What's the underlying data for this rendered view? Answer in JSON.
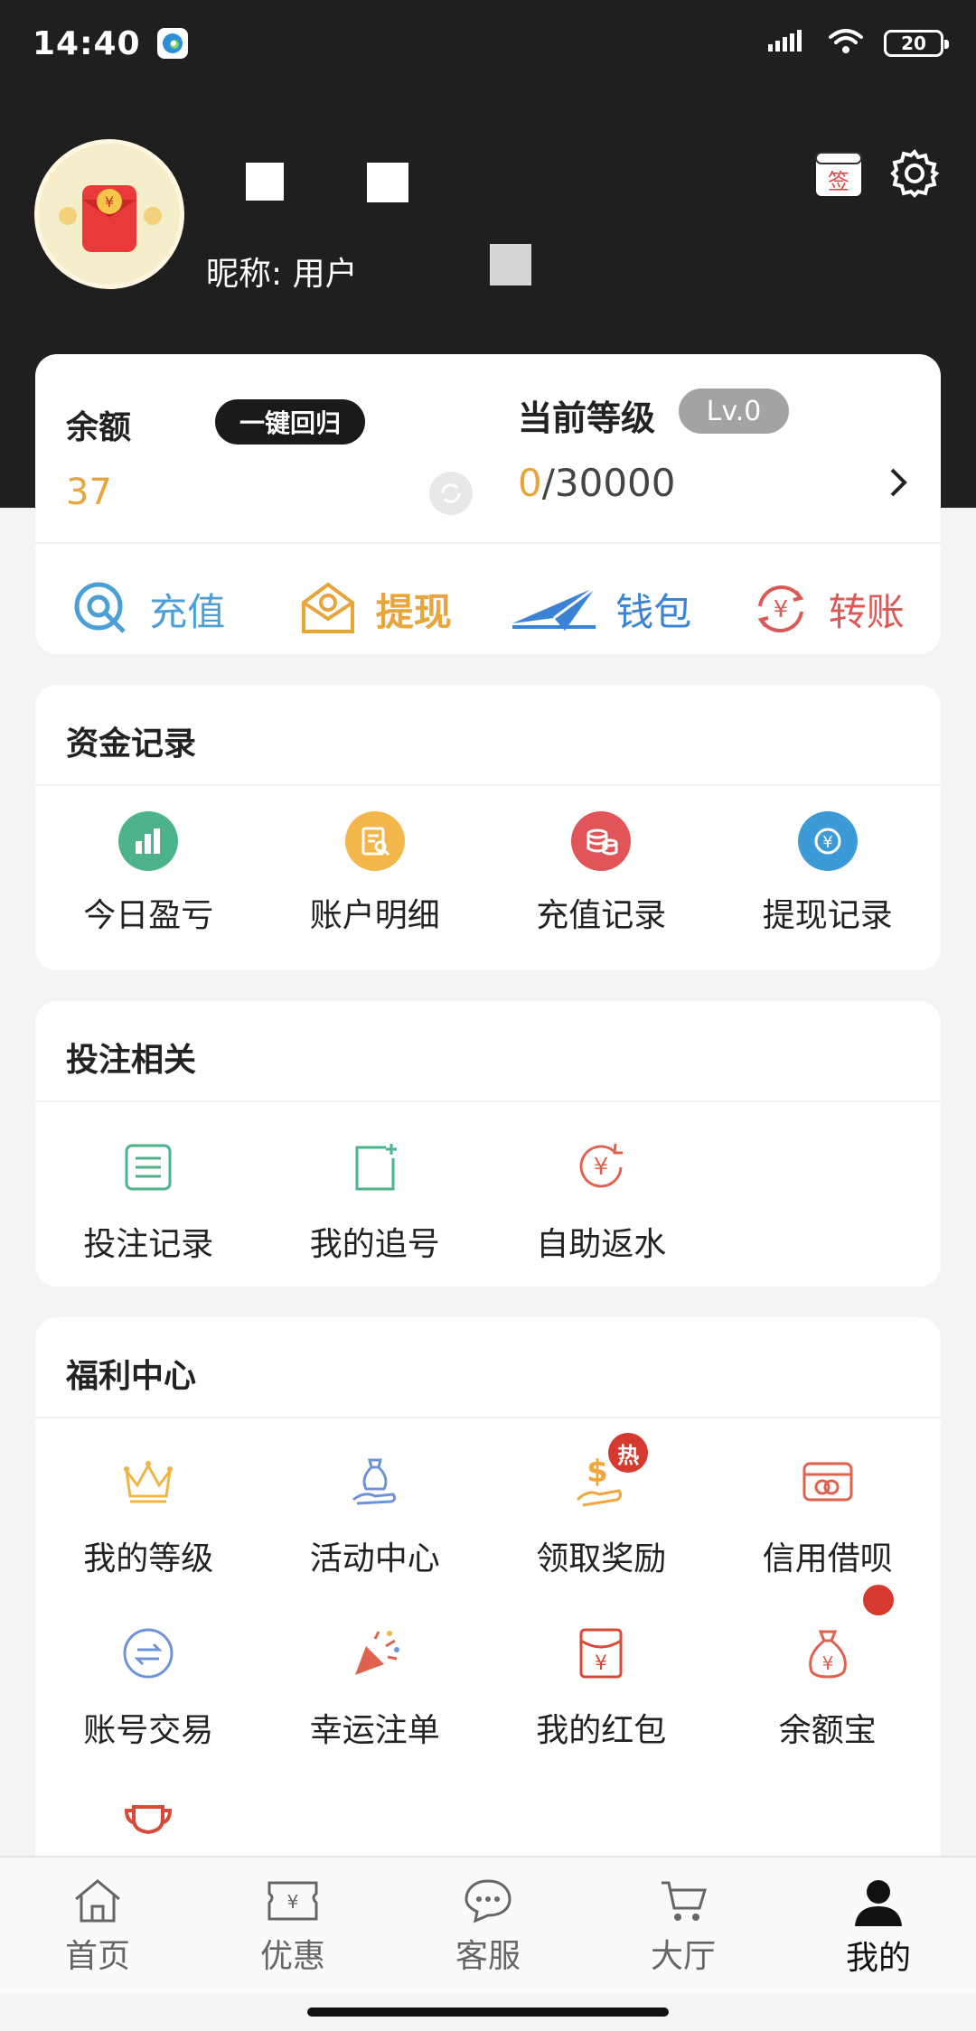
{
  "status_bar": {
    "time": "14:40",
    "battery": "20"
  },
  "profile": {
    "nickname": "昵称: 用户"
  },
  "balance": {
    "label": "余额",
    "value": "37",
    "oneclick_label": "一键回归"
  },
  "level": {
    "label": "当前等级",
    "badge": "Lv.0",
    "current": "0",
    "target": "/30000"
  },
  "quick_actions": [
    {
      "label": "充值",
      "color": "#4b9fd5",
      "icon": "recharge-icon"
    },
    {
      "label": "提现",
      "color": "#e7a53b",
      "icon": "withdraw-icon"
    },
    {
      "label": "钱包",
      "color": "#3a82d4",
      "icon": "wallet-icon"
    },
    {
      "label": "转账",
      "color": "#dc5a55",
      "icon": "transfer-icon"
    }
  ],
  "funds": {
    "title": "资金记录",
    "items": [
      {
        "label": "今日盈亏",
        "icon": "chart-icon",
        "color": "#4db38a"
      },
      {
        "label": "账户明细",
        "icon": "document-icon",
        "color": "#f3b64b"
      },
      {
        "label": "充值记录",
        "icon": "coins-icon",
        "color": "#e15558"
      },
      {
        "label": "提现记录",
        "icon": "withdraw-record-icon",
        "color": "#3c9bd6"
      }
    ]
  },
  "betting": {
    "title": "投注相关",
    "items": [
      {
        "label": "投注记录",
        "icon": "list-icon"
      },
      {
        "label": "我的追号",
        "icon": "add-note-icon"
      },
      {
        "label": "自助返水",
        "icon": "rebate-icon"
      }
    ]
  },
  "welfare": {
    "title": "福利中心",
    "items": [
      {
        "label": "我的等级",
        "icon": "crown-icon"
      },
      {
        "label": "活动中心",
        "icon": "activity-icon"
      },
      {
        "label": "领取奖励",
        "icon": "reward-icon",
        "badge": "热"
      },
      {
        "label": "信用借呗",
        "icon": "credit-card-icon"
      },
      {
        "label": "账号交易",
        "icon": "exchange-icon"
      },
      {
        "label": "幸运注单",
        "icon": "party-popper-icon"
      },
      {
        "label": "我的红包",
        "icon": "red-envelope-icon"
      },
      {
        "label": "余额宝",
        "icon": "money-bag-icon"
      }
    ]
  },
  "nav": [
    {
      "label": "首页",
      "icon": "home-icon"
    },
    {
      "label": "优惠",
      "icon": "coupon-icon"
    },
    {
      "label": "客服",
      "icon": "chat-icon"
    },
    {
      "label": "大厅",
      "icon": "cart-icon"
    },
    {
      "label": "我的",
      "icon": "user-icon",
      "active": true
    }
  ]
}
